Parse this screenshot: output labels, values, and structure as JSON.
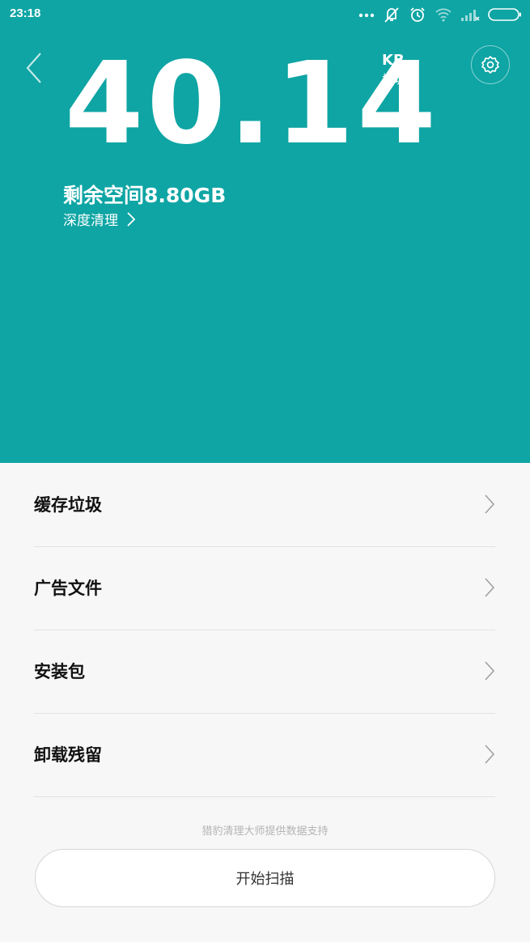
{
  "status_bar": {
    "time": "23:18"
  },
  "header": {
    "junk_amount": "40.14",
    "junk_unit": "KB",
    "junk_unit_label": "垃圾",
    "remaining_space": "剩余空间8.80GB",
    "deep_clean_label": "深度清理",
    "background_color": "#0ea5a4"
  },
  "list": {
    "items": [
      {
        "label": "缓存垃圾"
      },
      {
        "label": "广告文件"
      },
      {
        "label": "安装包"
      },
      {
        "label": "卸载残留"
      }
    ]
  },
  "footer": {
    "note": "猎豹清理大师提供数据支持",
    "scan_button_label": "开始扫描"
  }
}
